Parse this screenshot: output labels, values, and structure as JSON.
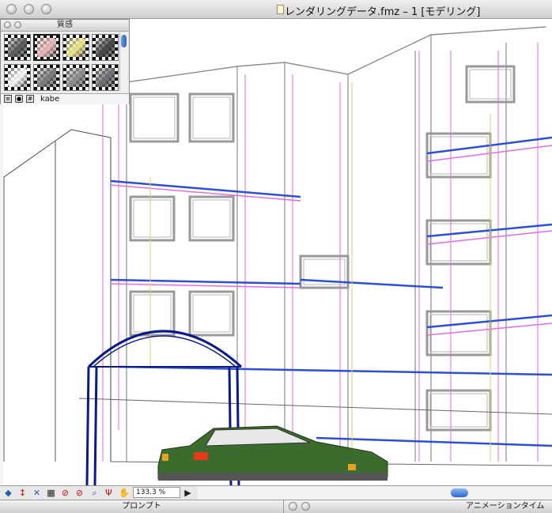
{
  "window": {
    "title": "レンダリングデータ.fmz – 1 [モデリング]"
  },
  "material_palette": {
    "title": "質感",
    "selected_name": "kabe",
    "swatches": [
      {
        "name": "dark-gray",
        "color": "#5a5a5a"
      },
      {
        "name": "pink",
        "color": "#e6b6b6"
      },
      {
        "name": "yellow",
        "color": "#e8e28a"
      },
      {
        "name": "charcoal",
        "color": "#444444"
      },
      {
        "name": "white",
        "color": "#f4f4f4"
      },
      {
        "name": "stone",
        "color": "#7a7a7a"
      },
      {
        "name": "gray",
        "color": "#8c8c8c"
      },
      {
        "name": "slate",
        "color": "#6e6e72"
      }
    ],
    "footer_icons": [
      "list-view-icon",
      "sphere-icon",
      "grid-icon"
    ]
  },
  "toolbar": {
    "zoom": "133.3 %",
    "icons": [
      "move-view-icon",
      "arrow-updown-icon",
      "cross-icon",
      "grid-view-icon",
      "no-entry-icon",
      "no-entry-icon",
      "magnifier-icon",
      "walk-icon",
      "play-triangle-icon"
    ]
  },
  "panels": {
    "prompt": "プロンプト",
    "animation": "アニメーションタイム"
  },
  "colors": {
    "accent_blue": "#2b4fd6",
    "accent_pink": "#e66ae6",
    "arch_navy": "#0a1a8c",
    "car_green": "#3c6b2e"
  }
}
